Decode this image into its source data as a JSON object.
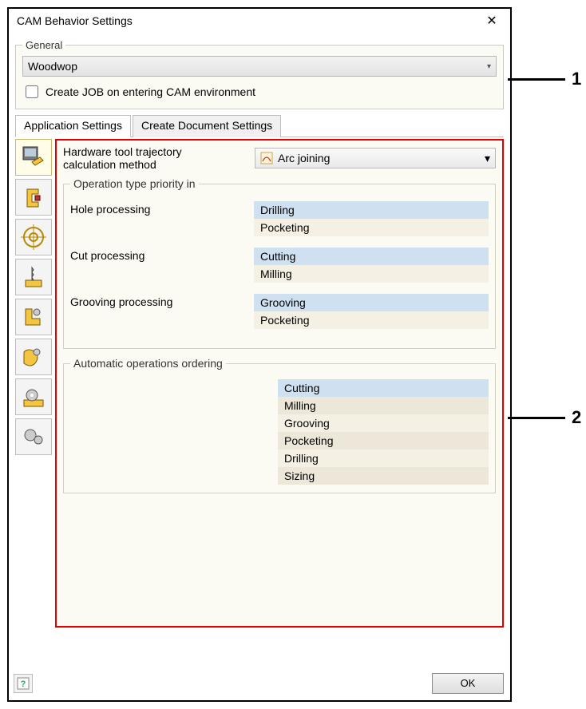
{
  "window": {
    "title": "CAM Behavior Settings"
  },
  "general": {
    "legend": "General",
    "combo_value": "Woodwop",
    "checkbox_label": "Create JOB on entering CAM environment"
  },
  "tabs": {
    "app": "Application Settings",
    "doc": "Create Document Settings"
  },
  "sidebar_icons": [
    "cam-settings-icon",
    "clamp-icon",
    "target-icon",
    "drill-icon",
    "tool-icon",
    "pocket-icon",
    "gear-base-icon",
    "gear-two-icon"
  ],
  "panel": {
    "trajectory_label": "Hardware tool trajectory\ncalculation method",
    "trajectory_value": "Arc joining",
    "priority_legend": "Operation type priority in",
    "hole_label": "Hole processing",
    "hole_items": [
      "Drilling",
      "Pocketing"
    ],
    "cut_label": "Cut processing",
    "cut_items": [
      "Cutting",
      "Milling"
    ],
    "groove_label": "Grooving processing",
    "groove_items": [
      "Grooving",
      "Pocketing"
    ],
    "auto_legend": "Automatic operations ordering",
    "auto_items": [
      "Cutting",
      "Milling",
      "Grooving",
      "Pocketing",
      "Drilling",
      "Sizing"
    ]
  },
  "footer": {
    "ok": "OK"
  },
  "callouts": {
    "c1": "1",
    "c2": "2"
  }
}
